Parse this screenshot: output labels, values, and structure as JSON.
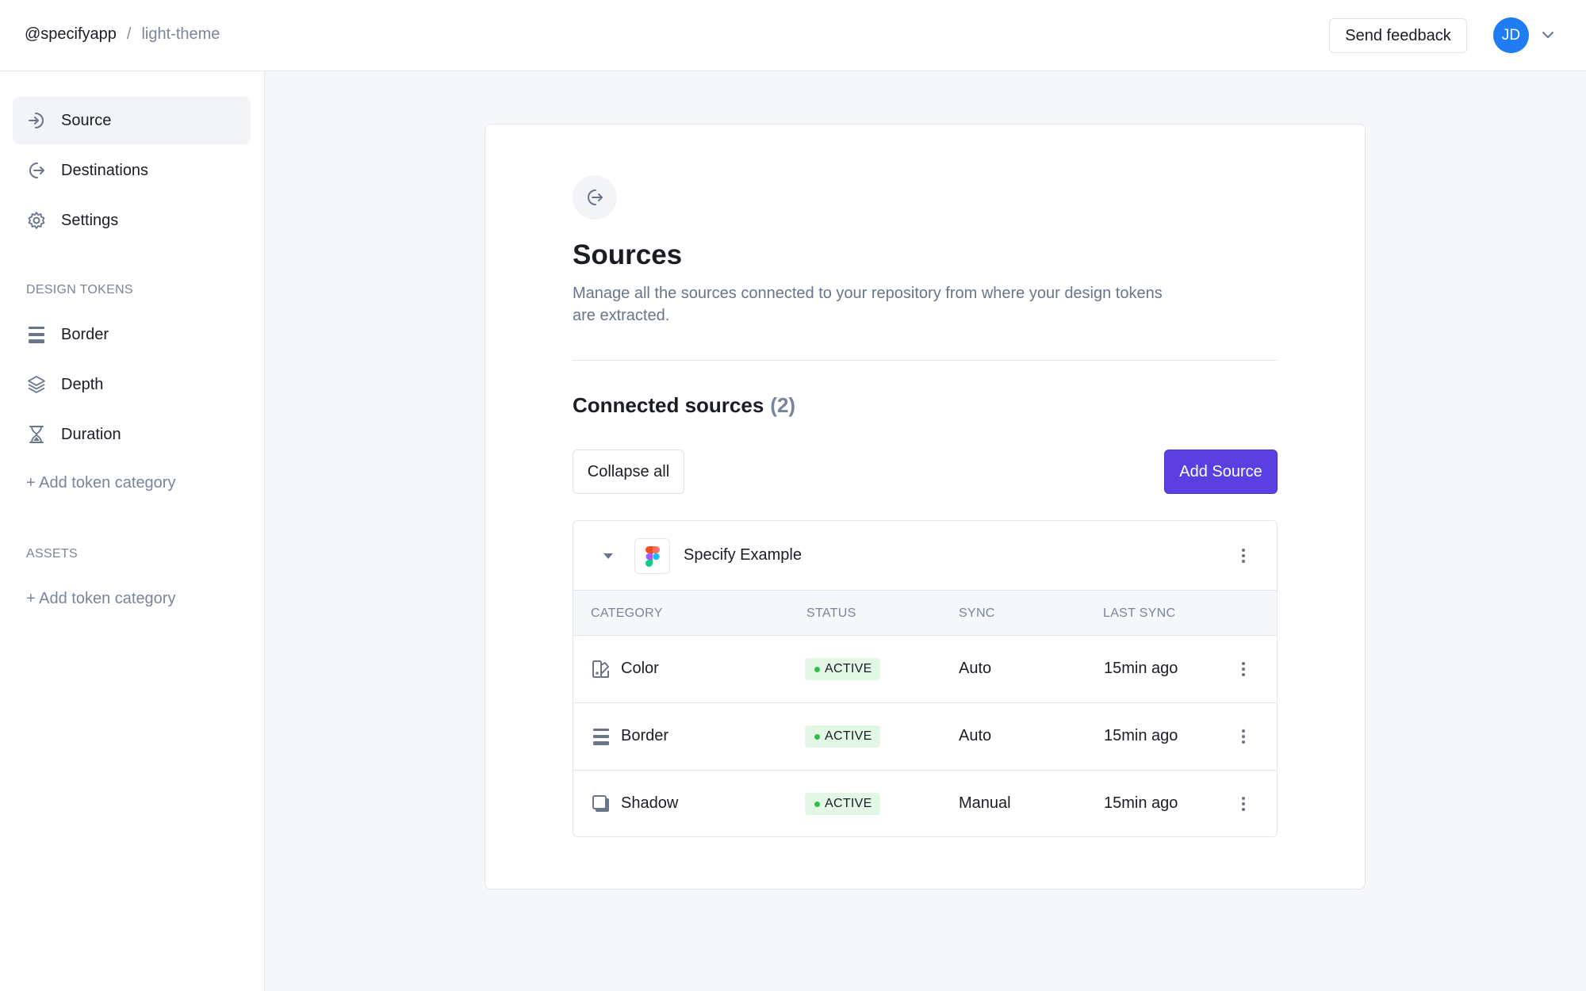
{
  "header": {
    "org": "@specifyapp",
    "separator": "/",
    "repo": "light-theme",
    "feedback_label": "Send feedback",
    "avatar_initials": "JD"
  },
  "sidebar": {
    "items": [
      {
        "label": "Source",
        "icon": "arrow-in-icon",
        "active": true
      },
      {
        "label": "Destinations",
        "icon": "arrow-out-icon"
      },
      {
        "label": "Settings",
        "icon": "gear-icon"
      }
    ],
    "design_tokens_label": "DESIGN TOKENS",
    "token_items": [
      {
        "label": "Border",
        "icon": "border-lines-icon"
      },
      {
        "label": "Depth",
        "icon": "layers-icon"
      },
      {
        "label": "Duration",
        "icon": "hourglass-icon"
      }
    ],
    "add_token_category": "+ Add token category",
    "assets_label": "ASSETS",
    "add_asset_category": "+ Add token category"
  },
  "main": {
    "title": "Sources",
    "description": "Manage all the sources connected to your repository from where your design tokens are extracted.",
    "section_title": "Connected sources",
    "section_count": "(2)",
    "collapse_label": "Collapse all",
    "add_source_label": "Add Source",
    "source": {
      "name": "Specify Example",
      "columns": [
        "CATEGORY",
        "STATUS",
        "SYNC",
        "LAST SYNC"
      ],
      "rows": [
        {
          "category": "Color",
          "icon": "color-palette-icon",
          "status": "ACTIVE",
          "sync": "Auto",
          "last_sync": "15min ago"
        },
        {
          "category": "Border",
          "icon": "border-lines-icon",
          "status": "ACTIVE",
          "sync": "Auto",
          "last_sync": "15min ago"
        },
        {
          "category": "Shadow",
          "icon": "shadow-icon",
          "status": "ACTIVE",
          "sync": "Manual",
          "last_sync": "15min ago"
        }
      ]
    }
  },
  "colors": {
    "accent": "#5b3fe0",
    "avatar": "#1f7cf2",
    "active_badge_bg": "#e3f7e6",
    "active_dot": "#2fbf4a"
  }
}
